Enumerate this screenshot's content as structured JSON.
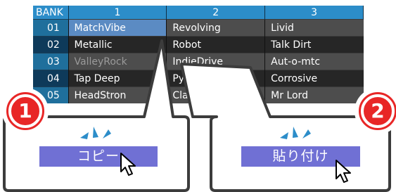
{
  "table": {
    "headers": [
      "BANK",
      "1",
      "2",
      "3"
    ],
    "rows": [
      {
        "num": "01",
        "cells": [
          "MatchVibe",
          "Revolving",
          "Livid"
        ]
      },
      {
        "num": "02",
        "cells": [
          "Metallic",
          "Robot",
          "Talk Dirt"
        ]
      },
      {
        "num": "03",
        "cells": [
          "ValleyRock",
          "IndieDrive",
          "Aut-o-mtc"
        ]
      },
      {
        "num": "04",
        "cells": [
          "Tap Deep",
          "PyschClas",
          "Corrosive"
        ]
      },
      {
        "num": "05",
        "cells": [
          "HeadStron",
          "Class A",
          "Mr Lord"
        ]
      }
    ]
  },
  "steps": [
    {
      "number": "1",
      "menu_label": "コピー"
    },
    {
      "number": "2",
      "menu_label": "貼り付け"
    }
  ],
  "colors": {
    "step_badge": "#e82626",
    "menu_item": "#7070d4",
    "selected_cell": "#5b8bc3",
    "sparkle": "#2c8dc9"
  }
}
